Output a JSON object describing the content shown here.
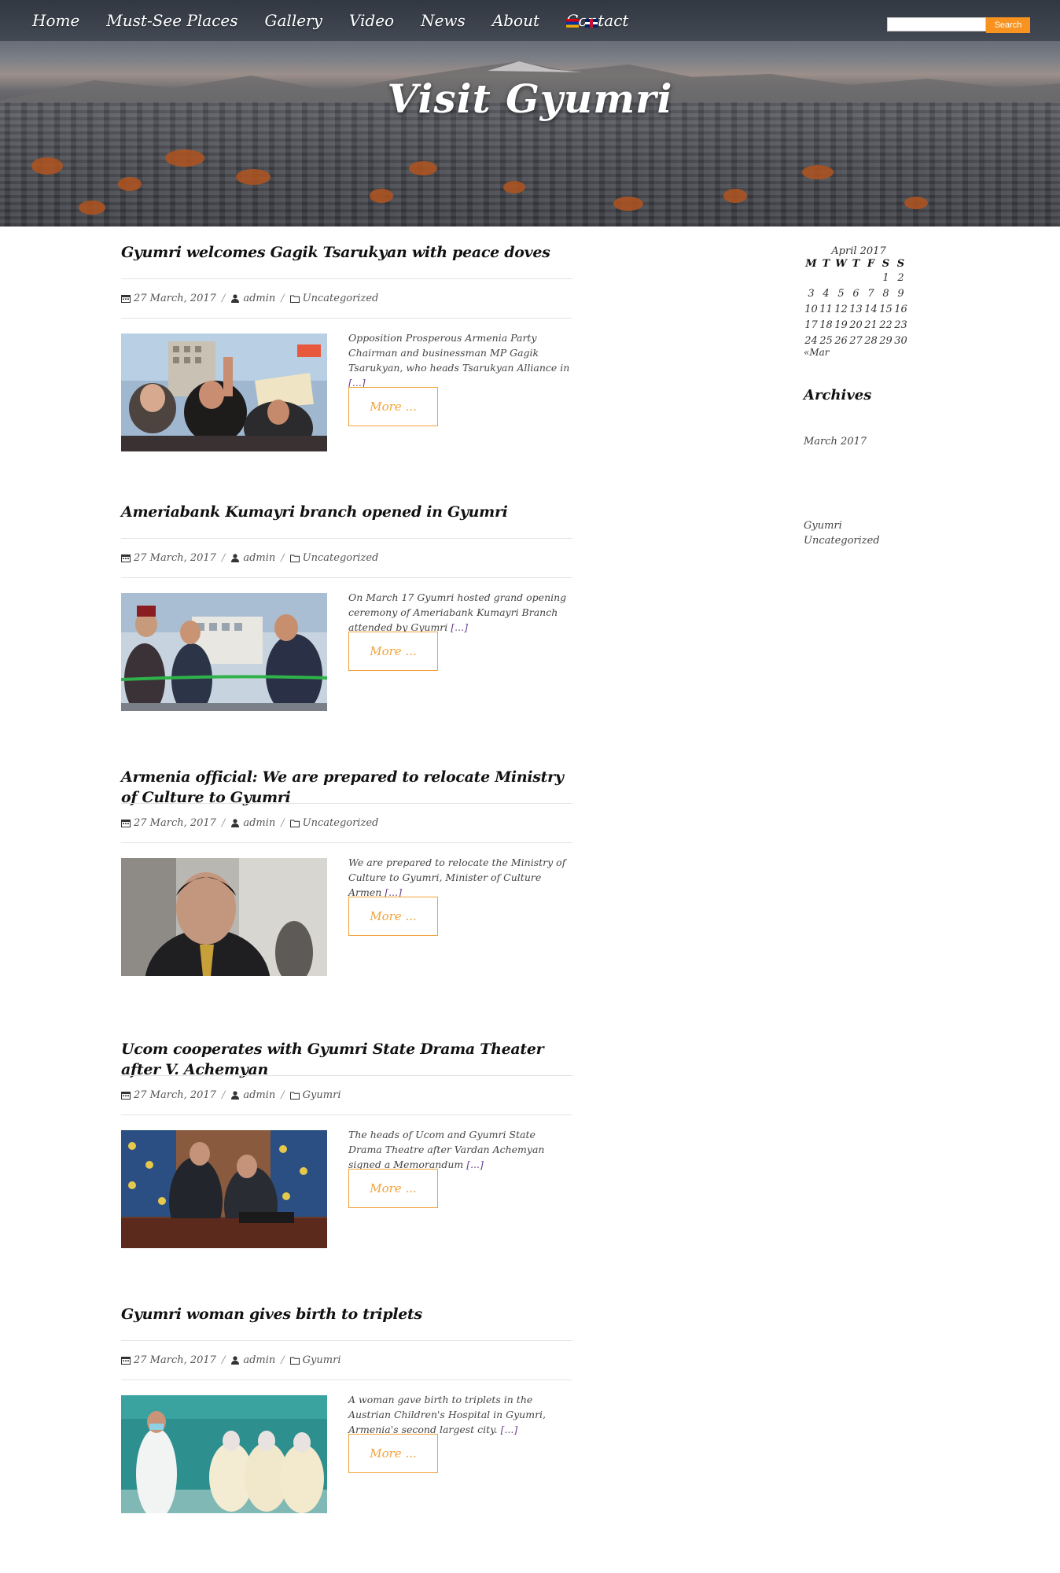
{
  "nav": {
    "items": [
      "Home",
      "Must-See Places",
      "Gallery",
      "Video",
      "News",
      "About",
      "Contact"
    ]
  },
  "search": {
    "button": "Search",
    "placeholder": ""
  },
  "site": {
    "title": "Visit Gyumri"
  },
  "posts": [
    {
      "title": "Gyumri welcomes Gagik Tsarukyan with peace doves",
      "date": "27 March, 2017",
      "author": "admin",
      "category": "Uncategorized",
      "excerpt": "Opposition Prosperous Armenia Party Chairman and businessman MP Gagik Tsarukyan, who heads Tsarukyan Alliance in",
      "ellipsis": "[...]",
      "more": "More ..."
    },
    {
      "title": "Ameriabank Kumayri branch opened in Gyumri",
      "date": "27 March, 2017",
      "author": "admin",
      "category": "Uncategorized",
      "excerpt": "On March 17 Gyumri hosted grand opening ceremony of Ameriabank Kumayri Branch attended by Gyumri",
      "ellipsis": "[...]",
      "more": "More ..."
    },
    {
      "title": "Armenia official: We are prepared to relocate Ministry of Culture to Gyumri",
      "date": "27 March, 2017",
      "author": "admin",
      "category": "Uncategorized",
      "excerpt": "We are prepared to relocate the Ministry of Culture to Gyumri, Minister of Culture Armen",
      "ellipsis": "[...]",
      "more": "More ..."
    },
    {
      "title": "Ucom cooperates with Gyumri State Drama Theater after V. Achemyan",
      "date": "27 March, 2017",
      "author": "admin",
      "category": "Gyumri",
      "excerpt": "The heads of Ucom and Gyumri State Drama Theatre after Vardan Achemyan signed a Memorandum",
      "ellipsis": "[...]",
      "more": "More ..."
    },
    {
      "title": "Gyumri woman gives birth to triplets",
      "date": "27 March, 2017",
      "author": "admin",
      "category": "Gyumri",
      "excerpt": "A woman gave birth to triplets in the Austrian Children's Hospital in Gyumri, Armenia's second largest city.",
      "ellipsis": "[...]",
      "more": "More ..."
    }
  ],
  "calendar": {
    "caption": "April 2017",
    "days": [
      "M",
      "T",
      "W",
      "T",
      "F",
      "S",
      "S"
    ],
    "weeks": [
      [
        "",
        "",
        "",
        "",
        "",
        "1",
        "2"
      ],
      [
        "3",
        "4",
        "5",
        "6",
        "7",
        "8",
        "9"
      ],
      [
        "10",
        "11",
        "12",
        "13",
        "14",
        "15",
        "16"
      ],
      [
        "17",
        "18",
        "19",
        "20",
        "21",
        "22",
        "23"
      ],
      [
        "24",
        "25",
        "26",
        "27",
        "28",
        "29",
        "30"
      ]
    ],
    "prev": "«Mar"
  },
  "archives": {
    "title": "Archives",
    "items": [
      "March 2017"
    ]
  },
  "categories": {
    "items": [
      "Gyumri",
      "Uncategorized"
    ]
  }
}
